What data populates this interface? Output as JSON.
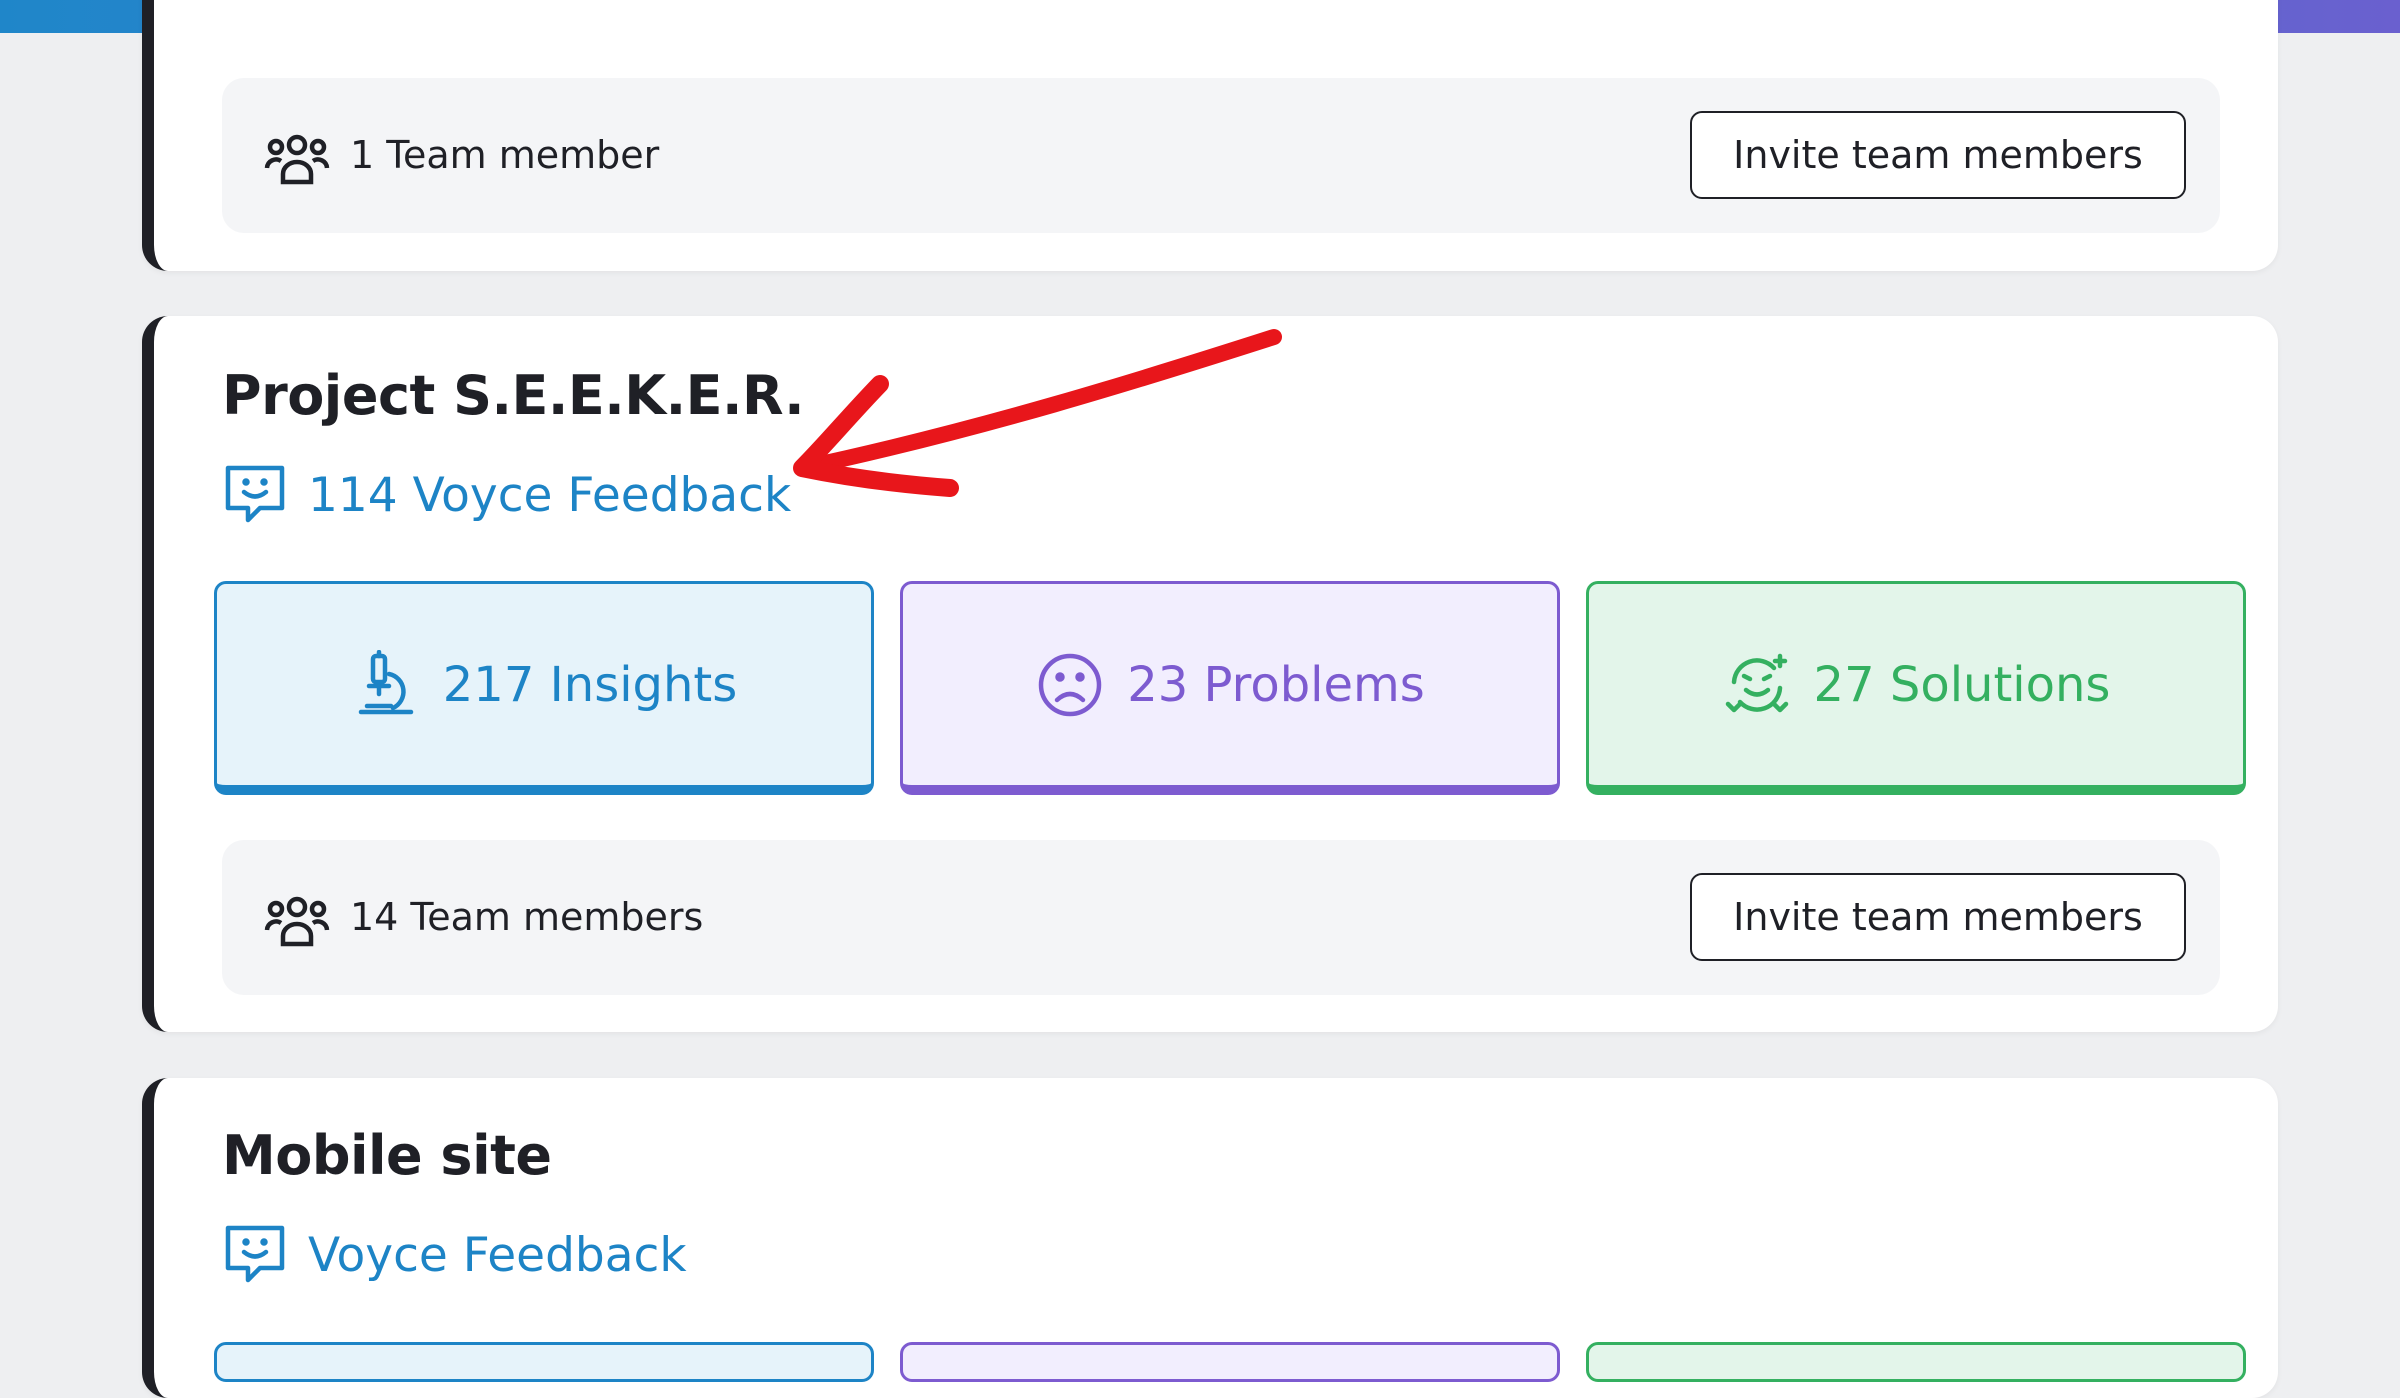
{
  "colors": {
    "accent_blue": "#1d84c6",
    "problems_purple": "#7d5bd0",
    "solutions_green": "#34b060",
    "annotation_red": "#e8161b"
  },
  "cards": [
    {
      "team_text": "1 Team member",
      "invite_label": "Invite team members"
    },
    {
      "title": "Project S.E.E.K.E.R.",
      "feedback_label": "114 Voyce Feedback",
      "stats": {
        "insights": "217 Insights",
        "problems": "23 Problems",
        "solutions": "27 Solutions"
      },
      "team_text": "14 Team members",
      "invite_label": "Invite team members"
    },
    {
      "title": "Mobile site",
      "feedback_label": "Voyce Feedback"
    }
  ],
  "icons": {
    "people": "people-icon",
    "feedback": "chat-smile-icon",
    "insights": "microscope-icon",
    "problems": "sad-face-icon",
    "solutions": "idea-face-icon",
    "annotation": "red-arrow"
  }
}
